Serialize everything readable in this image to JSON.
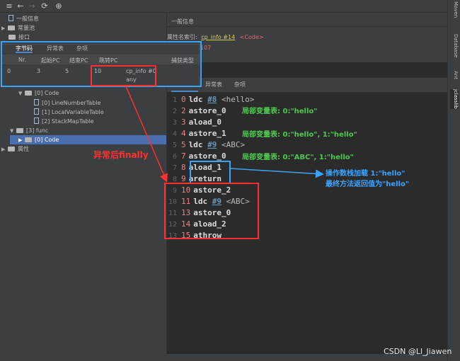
{
  "left_tree": [
    {
      "label": "一般信息",
      "icon": "file-icon",
      "indent": 0
    },
    {
      "label": "常量池",
      "icon": "folder-icon",
      "indent": 0
    },
    {
      "label": "接口",
      "icon": "folder-icon",
      "indent": 0
    },
    {
      "label": "[0] Code",
      "icon": "folder-icon",
      "indent": 2
    },
    {
      "label": "[0] LineNumberTable",
      "icon": "file-icon",
      "indent": 3
    },
    {
      "label": "[1] LocalVariableTable",
      "icon": "file-icon",
      "indent": 3
    },
    {
      "label": "[2] StackMapTable",
      "icon": "file-icon",
      "indent": 3
    },
    {
      "label": "[3] func",
      "icon": "folder-icon",
      "indent": 1
    },
    {
      "label": "[0] Code",
      "icon": "folder-icon",
      "indent": 2
    },
    {
      "label": "属性",
      "icon": "folder-icon",
      "indent": 0
    }
  ],
  "popup": {
    "tabs": [
      "字节码",
      "异常表",
      "杂项"
    ],
    "columns": [
      "Nr.",
      "起始PC",
      "结束PC",
      "跳转PC",
      "捕获类型"
    ],
    "row": {
      "nr": "0",
      "start": "3",
      "end": "5",
      "handler": "10",
      "type_ref": "cp_info #0",
      "type_name": "any"
    }
  },
  "right": {
    "title": "一般信息",
    "attr_label": "属性名索引:",
    "attr_ref": "cp_info #14",
    "attr_name": "<Code>",
    "length_value": "107",
    "tabs": [
      "异常表",
      "杂项"
    ]
  },
  "code": [
    {
      "ln": "1",
      "off": "0",
      "op": "ldc",
      "ref": "#8",
      "arg": "<hello>"
    },
    {
      "ln": "2",
      "off": "2",
      "op": "astore_0",
      "ref": "",
      "arg": ""
    },
    {
      "ln": "3",
      "off": "3",
      "op": "aload_0",
      "ref": "",
      "arg": ""
    },
    {
      "ln": "4",
      "off": "4",
      "op": "astore_1",
      "ref": "",
      "arg": ""
    },
    {
      "ln": "5",
      "off": "5",
      "op": "ldc",
      "ref": "#9",
      "arg": "<ABC>"
    },
    {
      "ln": "6",
      "off": "7",
      "op": "astore_0",
      "ref": "",
      "arg": ""
    },
    {
      "ln": "7",
      "off": "8",
      "op": "aload_1",
      "ref": "",
      "arg": ""
    },
    {
      "ln": "8",
      "off": "9",
      "op": "areturn",
      "ref": "",
      "arg": ""
    },
    {
      "ln": "9",
      "off": "10",
      "op": "astore_2",
      "ref": "",
      "arg": ""
    },
    {
      "ln": "10",
      "off": "11",
      "op": "ldc",
      "ref": "#9",
      "arg": "<ABC>"
    },
    {
      "ln": "11",
      "off": "13",
      "op": "astore_0",
      "ref": "",
      "arg": ""
    },
    {
      "ln": "12",
      "off": "14",
      "op": "aload_2",
      "ref": "",
      "arg": ""
    },
    {
      "ln": "13",
      "off": "15",
      "op": "athrow",
      "ref": "",
      "arg": ""
    }
  ],
  "annotations": {
    "local1": "局部变量表: 0:\"hello\"",
    "local2": "局部变量表: 0:\"hello\", 1:\"hello\"",
    "local3": "局部变量表: 0:\"ABC\", 1:\"hello\"",
    "stack1": "操作数栈加载 1:\"hello\"",
    "stack2": "最终方法返回值为\"hello\"",
    "finally": "异常后finally"
  },
  "sidebar_tabs": [
    "Maven",
    "Database",
    "Ant",
    "jclasslib"
  ],
  "watermark": "CSDN @Ll_Jiawen",
  "colors": {
    "red": "#ff3030",
    "blue": "#3aa3ff",
    "green": "#4ec94e",
    "selection": "#4b6eaf"
  }
}
